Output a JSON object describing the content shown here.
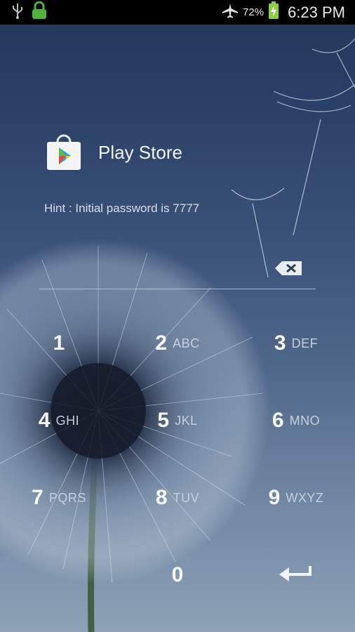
{
  "status_bar": {
    "battery_percent": "72%",
    "time": "6:23 PM",
    "icons": [
      "usb-icon",
      "lock-icon",
      "airplane-mode-icon",
      "battery-charging-icon"
    ]
  },
  "app": {
    "name": "Play Store",
    "icon": "play-store-icon"
  },
  "hint": "Hint : Initial password is 7777",
  "password_field": {
    "value": "",
    "backspace_icon": "backspace-icon"
  },
  "keypad": {
    "keys": [
      {
        "num": "1",
        "letters": ""
      },
      {
        "num": "2",
        "letters": "ABC"
      },
      {
        "num": "3",
        "letters": "DEF"
      },
      {
        "num": "4",
        "letters": "GHI"
      },
      {
        "num": "5",
        "letters": "JKL"
      },
      {
        "num": "6",
        "letters": "MNO"
      },
      {
        "num": "7",
        "letters": "PQRS"
      },
      {
        "num": "8",
        "letters": "TUV"
      },
      {
        "num": "9",
        "letters": "WXYZ"
      },
      {
        "num": "0",
        "letters": ""
      }
    ],
    "enter_icon": "enter-arrow-icon"
  }
}
